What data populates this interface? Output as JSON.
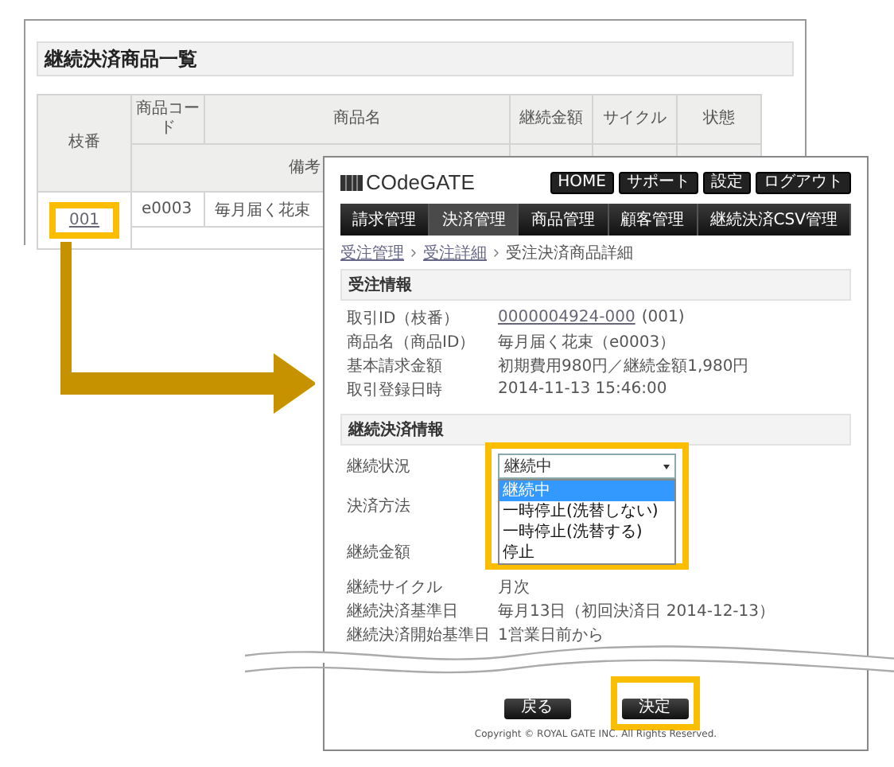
{
  "list_page": {
    "title": "継続決済商品一覧",
    "columns": [
      "枝番",
      "商品コード",
      "商品名",
      "継続金額",
      "サイクル",
      "状態"
    ],
    "subheader": "備考",
    "rows": [
      {
        "branch": "001",
        "code": "e0003",
        "name": "毎月届く花束",
        "highlighted": true
      }
    ]
  },
  "detail_page": {
    "logo": "COdeGATE",
    "header_buttons": [
      "HOME",
      "サポート",
      "設定",
      "ログアウト"
    ],
    "nav": [
      {
        "label": "請求管理",
        "selected": false
      },
      {
        "label": "決済管理",
        "selected": true
      },
      {
        "label": "商品管理",
        "selected": false
      },
      {
        "label": "顧客管理",
        "selected": false
      },
      {
        "label": "継続決済CSV管理",
        "selected": false
      }
    ],
    "breadcrumb": [
      "受注管理",
      "受注詳細",
      "受注決済商品詳細"
    ],
    "order_section": {
      "title": "受注情報",
      "rows": [
        {
          "label": "取引ID（枝番）",
          "link": "0000004924-000",
          "value": "(001)"
        },
        {
          "label": "商品名（商品ID）",
          "value": "毎月届く花束（e0003）"
        },
        {
          "label": "基本請求金額",
          "value": "初期費用980円／継続金額1,980円"
        },
        {
          "label": "取引登録日時",
          "value": "2014-11-13 15:46:00"
        }
      ]
    },
    "subscription_section": {
      "title": "継続決済情報",
      "rows": [
        {
          "label": "継続状況",
          "kind": "select",
          "value": "継続中",
          "expanded": true,
          "highlighted": true,
          "options": [
            {
              "label": "継続中",
              "selected": true
            },
            {
              "label": "一時停止(洗替しない)",
              "selected": false
            },
            {
              "label": "一時停止(洗替する)",
              "selected": false
            },
            {
              "label": "停止",
              "selected": false
            }
          ]
        },
        {
          "label": "決済方法",
          "kind": "text"
        },
        {
          "label": "継続金額",
          "kind": "text"
        },
        {
          "label": "継続サイクル",
          "kind": "text",
          "value": "月次"
        },
        {
          "label": "継続決済基準日",
          "kind": "text",
          "value": "毎月13日（初回決済日 2014-12-13）"
        },
        {
          "label": "継続決済開始基準日",
          "kind": "text",
          "value": "1営業日前から"
        }
      ]
    },
    "buttons": [
      {
        "label": "戻る",
        "highlighted": false
      },
      {
        "label": "決定",
        "highlighted": true
      }
    ],
    "copyright": "Copyright © ROYAL GATE INC. All Rights Reserved."
  }
}
